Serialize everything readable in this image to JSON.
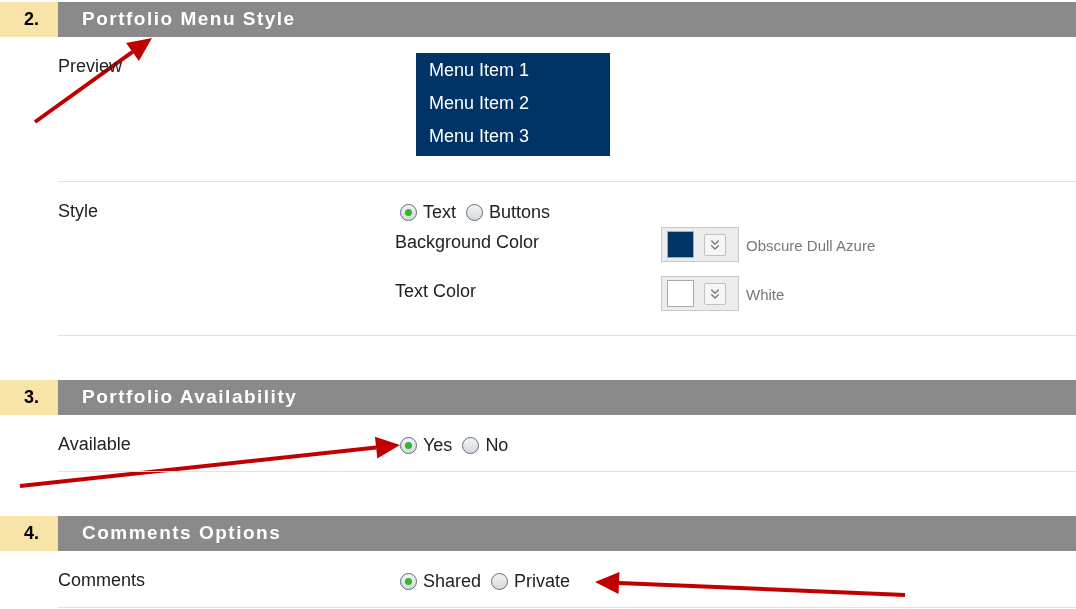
{
  "sections": [
    {
      "number": "2.",
      "title": "Portfolio Menu Style",
      "rows": [
        {
          "kind": "preview",
          "label": "Preview",
          "menu_items": [
            "Menu Item 1",
            "Menu Item 2",
            "Menu Item 3"
          ]
        },
        {
          "kind": "options",
          "label": "Style",
          "options": [
            {
              "label": "Text",
              "selected": true
            },
            {
              "label": "Buttons",
              "selected": false
            }
          ],
          "color_fields": [
            {
              "label": "Background Color",
              "color": "#003366",
              "color_name": "Obscure Dull Azure"
            },
            {
              "label": "Text Color",
              "color": "#ffffff",
              "color_name": "White"
            }
          ]
        }
      ]
    },
    {
      "number": "3.",
      "title": "Portfolio Availability",
      "rows": [
        {
          "kind": "options",
          "label": "Available",
          "options": [
            {
              "label": "Yes",
              "selected": true
            },
            {
              "label": "No",
              "selected": false
            }
          ]
        }
      ]
    },
    {
      "number": "4.",
      "title": "Comments Options",
      "rows": [
        {
          "kind": "options",
          "label": "Comments",
          "options": [
            {
              "label": "Shared",
              "selected": true
            },
            {
              "label": "Private",
              "selected": false
            }
          ]
        }
      ]
    }
  ]
}
